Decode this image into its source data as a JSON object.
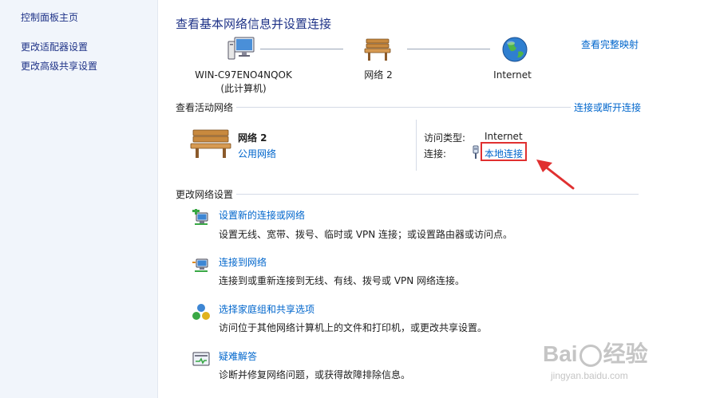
{
  "sidebar": {
    "items": [
      {
        "label": "控制面板主页"
      },
      {
        "label": "更改适配器设置"
      },
      {
        "label": "更改高级共享设置"
      }
    ]
  },
  "main": {
    "title": "查看基本网络信息并设置连接",
    "view_full_map": "查看完整映射",
    "map": {
      "computer_name": "WIN-C97ENO4NQOK",
      "computer_sub": "(此计算机)",
      "network_name": "网络  2",
      "internet": "Internet"
    },
    "active": {
      "section_label": "查看活动网络",
      "connect_disconnect": "连接或断开连接",
      "network_name": "网络  2",
      "network_type": "公用网络",
      "access_type_label": "访问类型:",
      "access_type_value": "Internet",
      "connections_label": "连接:",
      "connection_link": "本地连接"
    },
    "change": {
      "section_label": "更改网络设置",
      "tasks": [
        {
          "title": "设置新的连接或网络",
          "desc": "设置无线、宽带、拨号、临时或 VPN 连接；或设置路由器或访问点。",
          "icon": "new-connection-icon"
        },
        {
          "title": "连接到网络",
          "desc": "连接到或重新连接到无线、有线、拨号或 VPN 网络连接。",
          "icon": "connect-network-icon"
        },
        {
          "title": "选择家庭组和共享选项",
          "desc": "访问位于其他网络计算机上的文件和打印机，或更改共享设置。",
          "icon": "homegroup-icon"
        },
        {
          "title": "疑难解答",
          "desc": "诊断并修复网络问题，或获得故障排除信息。",
          "icon": "troubleshoot-icon"
        }
      ]
    }
  },
  "watermark": {
    "brand": "Bai",
    "brand_suffix": "经验",
    "url": "jingyan.baidu.com"
  },
  "colors": {
    "link": "#0066cc",
    "title": "#1e3287",
    "sidebar_bg": "#f1f5fb",
    "highlight": "#e03030"
  }
}
